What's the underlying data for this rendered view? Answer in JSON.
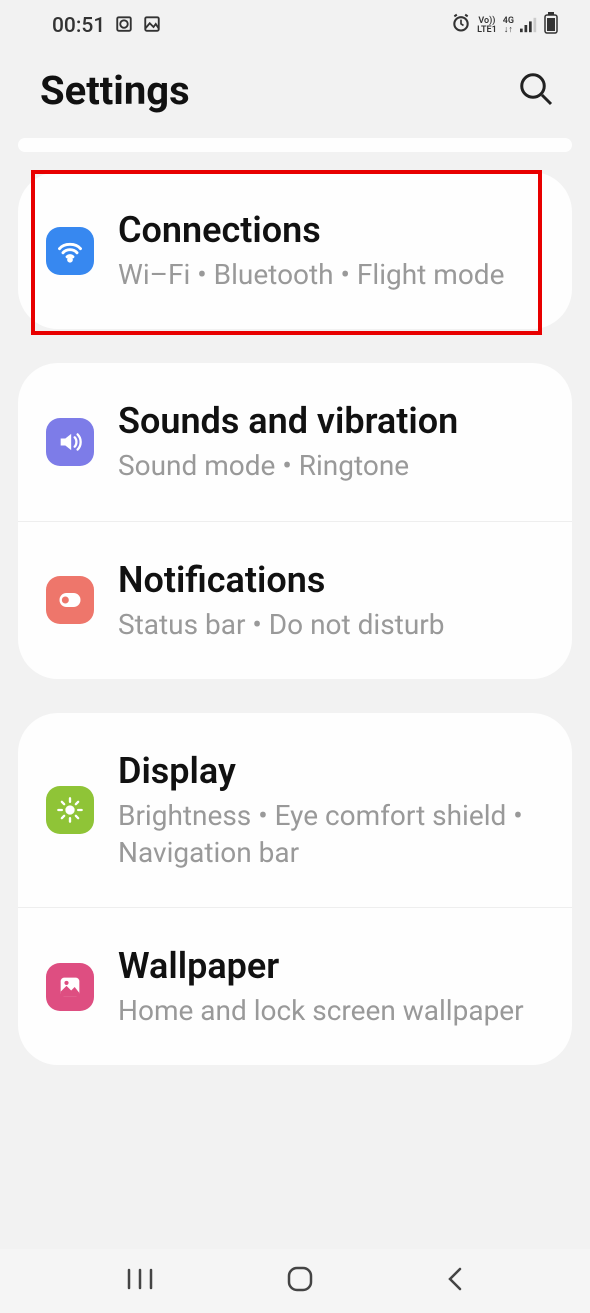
{
  "status": {
    "time": "00:51",
    "volte": "Vo))",
    "lte": "LTE1",
    "net": "4G"
  },
  "header": {
    "title": "Settings"
  },
  "groups": [
    {
      "highlighted": true,
      "items": [
        {
          "key": "connections",
          "title": "Connections",
          "subtitle": "Wi–Fi  •  Bluetooth  •  Flight mode",
          "iconClass": "icon-wifi"
        }
      ]
    },
    {
      "highlighted": false,
      "items": [
        {
          "key": "sounds",
          "title": "Sounds and vibration",
          "subtitle": "Sound mode  •  Ringtone",
          "iconClass": "icon-sound"
        },
        {
          "key": "notifications",
          "title": "Notifications",
          "subtitle": "Status bar  •  Do not disturb",
          "iconClass": "icon-notif"
        }
      ]
    },
    {
      "highlighted": false,
      "items": [
        {
          "key": "display",
          "title": "Display",
          "subtitle": "Brightness  •  Eye comfort shield  •  Navigation bar",
          "iconClass": "icon-display"
        },
        {
          "key": "wallpaper",
          "title": "Wallpaper",
          "subtitle": "Home and lock screen wallpaper",
          "iconClass": "icon-wallpaper"
        }
      ]
    }
  ]
}
